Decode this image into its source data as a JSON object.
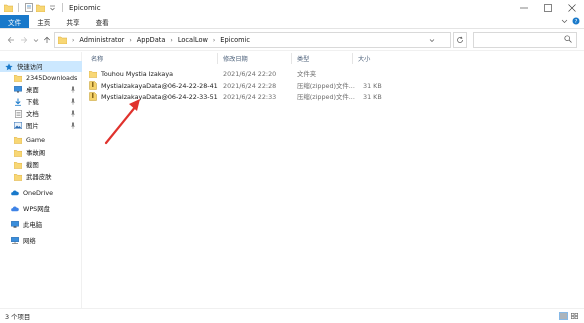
{
  "window": {
    "title": "Epicomic"
  },
  "ribbon": {
    "tabs": [
      "文件",
      "主页",
      "共享",
      "查看"
    ]
  },
  "address": {
    "crumbs": [
      "Administrator",
      "AppData",
      "LocalLow",
      "Epicomic"
    ]
  },
  "sidebar": {
    "items": [
      {
        "label": "快速访问",
        "icon": "star-icon",
        "active": true,
        "pinned": false
      },
      {
        "label": "2345Downloads",
        "icon": "folder-icon",
        "active": false,
        "pinned": true
      },
      {
        "label": "桌面",
        "icon": "desktop-icon",
        "active": false,
        "pinned": true
      },
      {
        "label": "下载",
        "icon": "download-icon",
        "active": false,
        "pinned": true
      },
      {
        "label": "文档",
        "icon": "document-icon",
        "active": false,
        "pinned": true
      },
      {
        "label": "图片",
        "icon": "picture-icon",
        "active": false,
        "pinned": true
      },
      {
        "label": "Game",
        "icon": "folder-icon",
        "active": false,
        "pinned": false
      },
      {
        "label": "事故阁",
        "icon": "folder-icon",
        "active": false,
        "pinned": false
      },
      {
        "label": "截图",
        "icon": "folder-icon",
        "active": false,
        "pinned": false
      },
      {
        "label": "武器皮肤",
        "icon": "folder-icon",
        "active": false,
        "pinned": false
      },
      {
        "label": "OneDrive",
        "icon": "cloud-icon",
        "active": false,
        "pinned": false
      },
      {
        "label": "WPS网盘",
        "icon": "wps-cloud-icon",
        "active": false,
        "pinned": false
      },
      {
        "label": "此电脑",
        "icon": "computer-icon",
        "active": false,
        "pinned": false
      },
      {
        "label": "网络",
        "icon": "network-icon",
        "active": false,
        "pinned": false
      }
    ]
  },
  "columns": {
    "name": "名称",
    "modified": "修改日期",
    "type": "类型",
    "size": "大小"
  },
  "files": [
    {
      "name": "Touhou Mystia Izakaya",
      "modified": "2021/6/24 22:20",
      "type": "文件夹",
      "size": "",
      "kind": "folder"
    },
    {
      "name": "MystiaIzakayaData@06-24-22-28-41",
      "modified": "2021/6/24 22:28",
      "type": "压缩(zipped)文件...",
      "size": "31 KB",
      "kind": "zip"
    },
    {
      "name": "MystiaIzakayaData@06-24-22-33-51",
      "modified": "2021/6/24 22:33",
      "type": "压缩(zipped)文件...",
      "size": "31 KB",
      "kind": "zip"
    }
  ],
  "status": {
    "item_count": "3 个项目"
  },
  "colors": {
    "accent": "#1979ca",
    "selected": "#cce8ff",
    "folder": "#f8d775",
    "arrow": "#e0322d"
  }
}
